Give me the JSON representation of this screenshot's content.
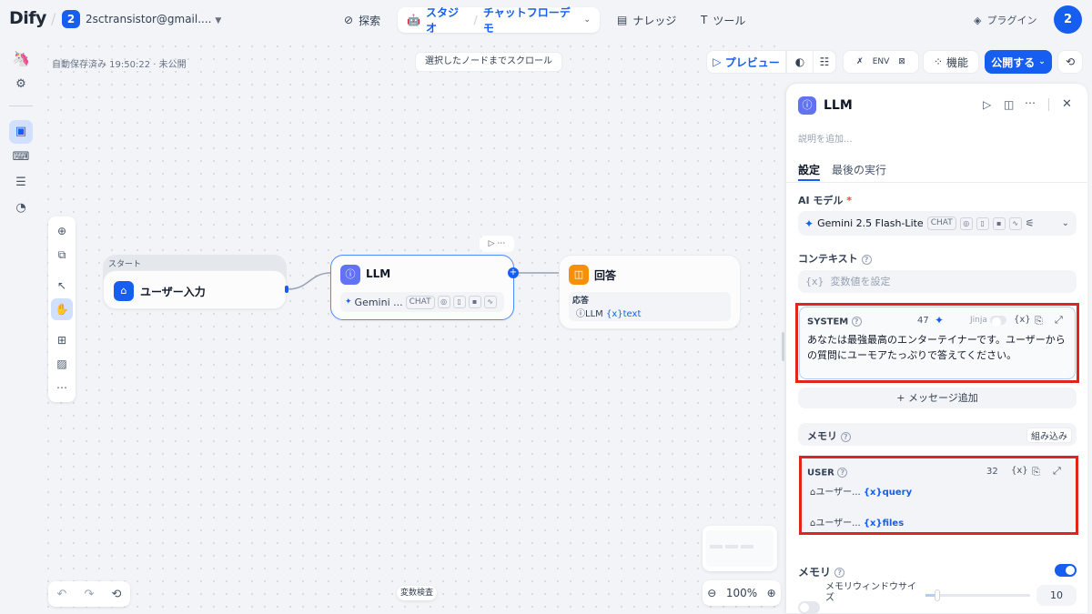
{
  "app": {
    "logo": "Dify",
    "workspace_badge": "2",
    "workspace_name": "2sctransistor@gmail...."
  },
  "nav": {
    "explore": "探索",
    "studio": "スタジオ",
    "app_name": "チャットフローデモ",
    "knowledge": "ナレッジ",
    "tools": "ツール",
    "plugins": "プラグイン",
    "avatar": "2"
  },
  "toolbar": {
    "autosave": "自動保存済み 19:50:22 · 未公開",
    "scroll_to_node": "選択したノードまでスクロール",
    "preview": "プレビュー",
    "features": "機能",
    "publish": "公開する",
    "env": "ENV"
  },
  "nodes": {
    "start": {
      "group_label": "スタート",
      "title": "ユーザー入力"
    },
    "llm": {
      "title": "LLM",
      "model": "Gemini ...",
      "mode": "CHAT"
    },
    "answer": {
      "title": "回答",
      "label": "応答",
      "var_node": "LLM",
      "var_name": "text"
    }
  },
  "bottom": {
    "var_inspect": "変数検査",
    "zoom": "100%"
  },
  "panel": {
    "title": "LLM",
    "description_placeholder": "説明を追加...",
    "tabs": [
      "設定",
      "最後の実行"
    ],
    "model_label": "AI モデル",
    "model_name": "Gemini 2.5 Flash-Lite",
    "model_mode": "CHAT",
    "context_label": "コンテキスト",
    "context_placeholder": "変数値を設定",
    "system": {
      "label": "SYSTEM",
      "count": "47",
      "jinja": "Jinja",
      "text": "あなたは最強最高のエンターテイナーです。ユーザーからの質問にユーモアたっぷりで答えてください。"
    },
    "add_message": "+ メッセージ追加",
    "memory_builtin_label": "メモリ",
    "memory_builtin_badge": "組み込み",
    "user": {
      "label": "USER",
      "count": "32",
      "var1_node": "ユーザー...",
      "var1_name": "query",
      "var2_node": "ユーザー...",
      "var2_name": "files"
    },
    "memory_label": "メモリ",
    "memory_window_label": "メモリウィンドウサイズ",
    "memory_window_value": "10"
  }
}
